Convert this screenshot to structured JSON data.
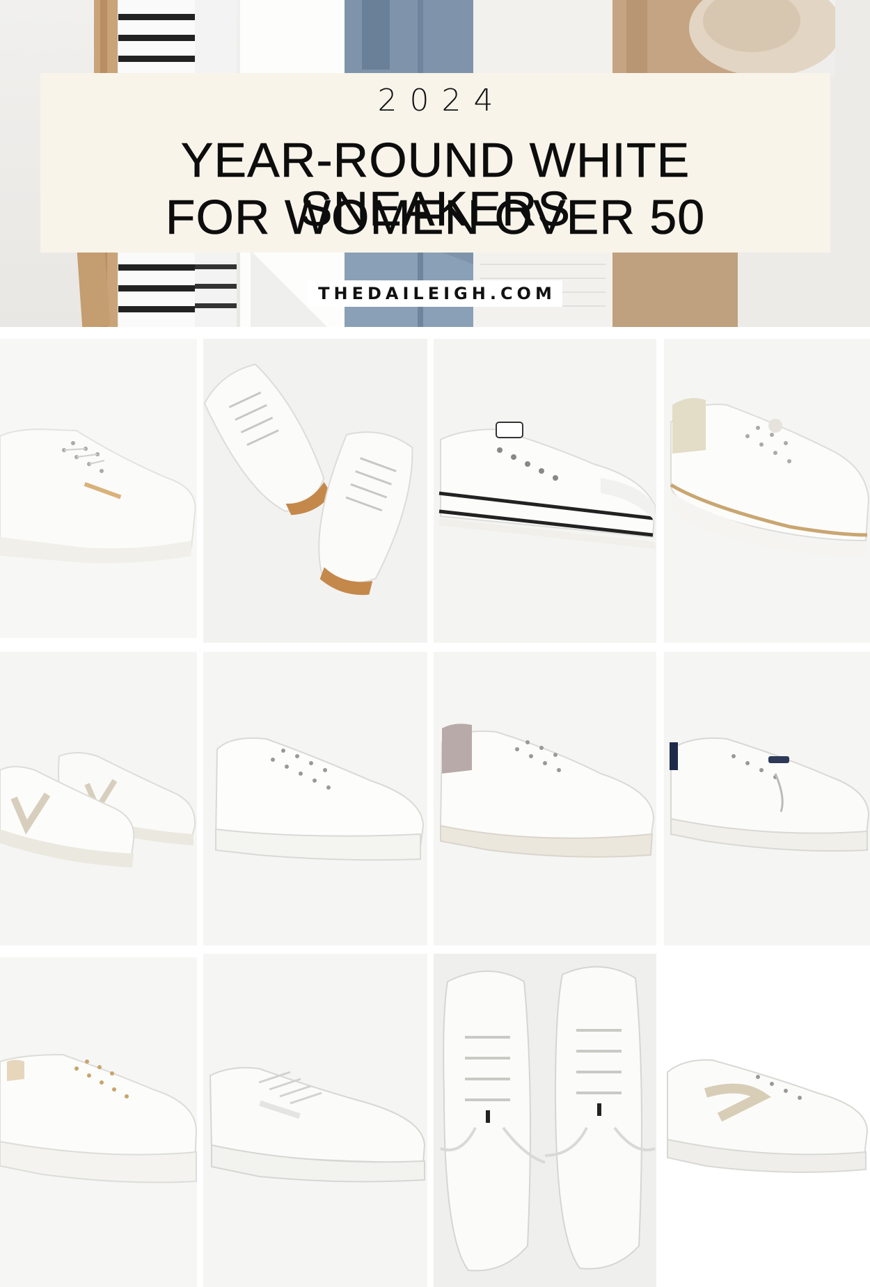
{
  "header": {
    "year": "2024",
    "title_line_1": "YEAR-ROUND WHITE SNEAKERS",
    "title_line_2": "FOR WOMEN OVER 50",
    "site": "THEDAILEIGH.COM"
  },
  "colors": {
    "title_panel": "#f8f4ea",
    "title_text": "#0d0d0d",
    "tile_background": "#f5f5f4",
    "sneaker_white": "#fbfbfa"
  },
  "products": [
    {
      "icon": "white-leather-sneaker-icon"
    },
    {
      "icon": "white-sneaker-pair-tan-heel-icon"
    },
    {
      "icon": "white-platform-canvas-sneaker-icon"
    },
    {
      "icon": "white-platform-sneaker-gold-trim-icon"
    },
    {
      "icon": "white-sneaker-pair-v-logo-icon"
    },
    {
      "icon": "white-canvas-low-top-sneaker-icon"
    },
    {
      "icon": "white-sneaker-mauve-heel-icon"
    },
    {
      "icon": "white-slip-on-boat-sneaker-icon"
    },
    {
      "icon": "white-platform-sneaker-gold-eyelets-icon"
    },
    {
      "icon": "white-canvas-classic-sneaker-icon"
    },
    {
      "icon": "white-knit-sneaker-pair-top-view-icon"
    },
    {
      "icon": "white-sneaker-beige-swoosh-icon"
    }
  ]
}
